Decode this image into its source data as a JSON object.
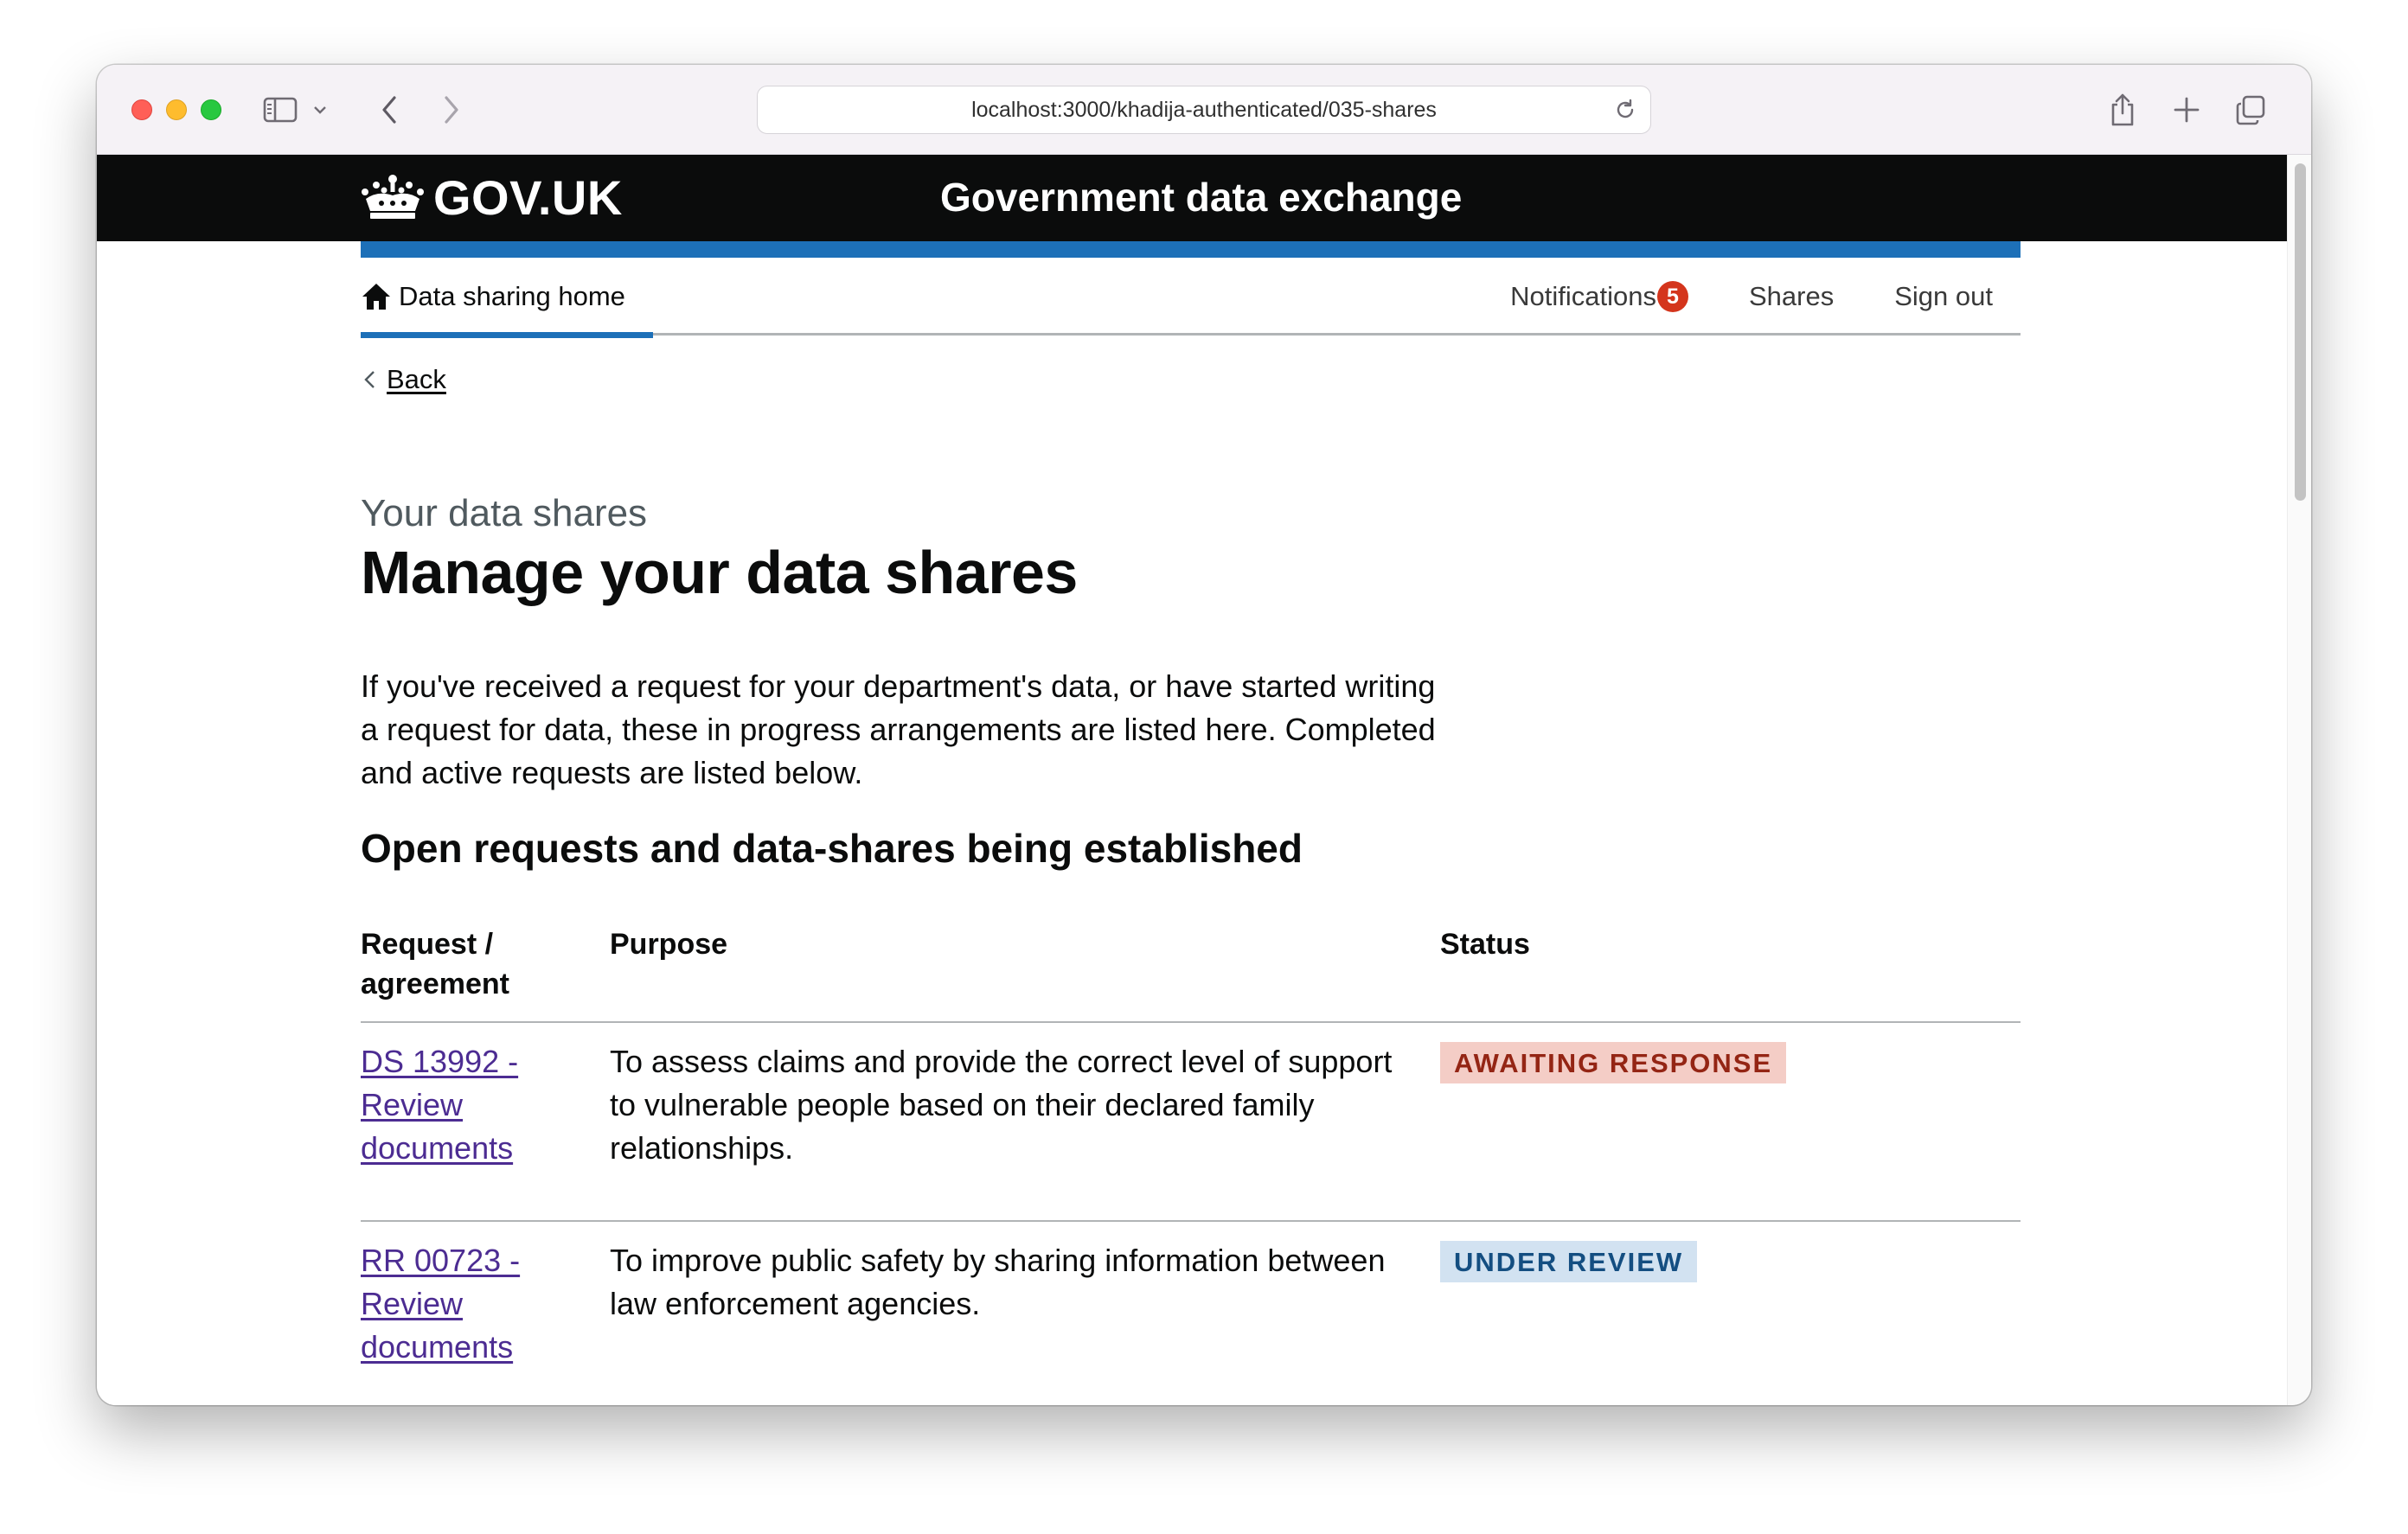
{
  "browser": {
    "url": "localhost:3000/khadija-authenticated/035-shares"
  },
  "header": {
    "logo_text": "GOV.UK",
    "service_name": "Government data exchange"
  },
  "nav": {
    "home_label": "Data sharing home",
    "notifications_label": "Notifications",
    "notifications_count": "5",
    "shares_label": "Shares",
    "sign_out_label": "Sign out"
  },
  "back_link": "Back",
  "page": {
    "caption": "Your data shares",
    "title": "Manage your data shares",
    "intro": "If you've received a request for your department's data, or have started writing a request for data, these in progress arrangements are listed here. Completed and active requests are listed below.",
    "section_heading": "Open requests and data-shares being established"
  },
  "table": {
    "headers": {
      "request": "Request / agreement",
      "purpose": "Purpose",
      "status": "Status"
    },
    "rows": [
      {
        "request_link": "DS 13992 - Review documents",
        "purpose": "To assess claims and provide the correct level of support to vulnerable people based on their declared family relationships.",
        "status": "AWAITING RESPONSE",
        "status_color": "#942514",
        "status_bg": "#f4cdc6"
      },
      {
        "request_link": "RR 00723 - Review documents",
        "purpose": "To improve public safety by sharing information between law enforcement agencies.",
        "status": "UNDER REVIEW",
        "status_color": "#144e81",
        "status_bg": "#d2e2f1"
      }
    ]
  },
  "colors": {
    "header_bg": "#0b0c0c",
    "brand_blue": "#1d70b8",
    "link_visited": "#4c2c92",
    "badge_red": "#d4351c"
  }
}
